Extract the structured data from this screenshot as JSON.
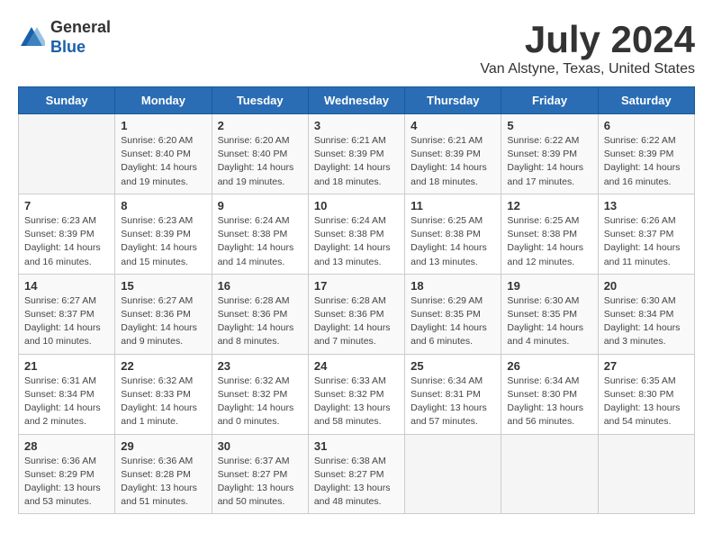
{
  "header": {
    "logo_general": "General",
    "logo_blue": "Blue",
    "month_title": "July 2024",
    "location": "Van Alstyne, Texas, United States"
  },
  "days_of_week": [
    "Sunday",
    "Monday",
    "Tuesday",
    "Wednesday",
    "Thursday",
    "Friday",
    "Saturday"
  ],
  "weeks": [
    [
      {
        "day": "",
        "text": ""
      },
      {
        "day": "1",
        "text": "Sunrise: 6:20 AM\nSunset: 8:40 PM\nDaylight: 14 hours\nand 19 minutes."
      },
      {
        "day": "2",
        "text": "Sunrise: 6:20 AM\nSunset: 8:40 PM\nDaylight: 14 hours\nand 19 minutes."
      },
      {
        "day": "3",
        "text": "Sunrise: 6:21 AM\nSunset: 8:39 PM\nDaylight: 14 hours\nand 18 minutes."
      },
      {
        "day": "4",
        "text": "Sunrise: 6:21 AM\nSunset: 8:39 PM\nDaylight: 14 hours\nand 18 minutes."
      },
      {
        "day": "5",
        "text": "Sunrise: 6:22 AM\nSunset: 8:39 PM\nDaylight: 14 hours\nand 17 minutes."
      },
      {
        "day": "6",
        "text": "Sunrise: 6:22 AM\nSunset: 8:39 PM\nDaylight: 14 hours\nand 16 minutes."
      }
    ],
    [
      {
        "day": "7",
        "text": "Sunrise: 6:23 AM\nSunset: 8:39 PM\nDaylight: 14 hours\nand 16 minutes."
      },
      {
        "day": "8",
        "text": "Sunrise: 6:23 AM\nSunset: 8:39 PM\nDaylight: 14 hours\nand 15 minutes."
      },
      {
        "day": "9",
        "text": "Sunrise: 6:24 AM\nSunset: 8:38 PM\nDaylight: 14 hours\nand 14 minutes."
      },
      {
        "day": "10",
        "text": "Sunrise: 6:24 AM\nSunset: 8:38 PM\nDaylight: 14 hours\nand 13 minutes."
      },
      {
        "day": "11",
        "text": "Sunrise: 6:25 AM\nSunset: 8:38 PM\nDaylight: 14 hours\nand 13 minutes."
      },
      {
        "day": "12",
        "text": "Sunrise: 6:25 AM\nSunset: 8:38 PM\nDaylight: 14 hours\nand 12 minutes."
      },
      {
        "day": "13",
        "text": "Sunrise: 6:26 AM\nSunset: 8:37 PM\nDaylight: 14 hours\nand 11 minutes."
      }
    ],
    [
      {
        "day": "14",
        "text": "Sunrise: 6:27 AM\nSunset: 8:37 PM\nDaylight: 14 hours\nand 10 minutes."
      },
      {
        "day": "15",
        "text": "Sunrise: 6:27 AM\nSunset: 8:36 PM\nDaylight: 14 hours\nand 9 minutes."
      },
      {
        "day": "16",
        "text": "Sunrise: 6:28 AM\nSunset: 8:36 PM\nDaylight: 14 hours\nand 8 minutes."
      },
      {
        "day": "17",
        "text": "Sunrise: 6:28 AM\nSunset: 8:36 PM\nDaylight: 14 hours\nand 7 minutes."
      },
      {
        "day": "18",
        "text": "Sunrise: 6:29 AM\nSunset: 8:35 PM\nDaylight: 14 hours\nand 6 minutes."
      },
      {
        "day": "19",
        "text": "Sunrise: 6:30 AM\nSunset: 8:35 PM\nDaylight: 14 hours\nand 4 minutes."
      },
      {
        "day": "20",
        "text": "Sunrise: 6:30 AM\nSunset: 8:34 PM\nDaylight: 14 hours\nand 3 minutes."
      }
    ],
    [
      {
        "day": "21",
        "text": "Sunrise: 6:31 AM\nSunset: 8:34 PM\nDaylight: 14 hours\nand 2 minutes."
      },
      {
        "day": "22",
        "text": "Sunrise: 6:32 AM\nSunset: 8:33 PM\nDaylight: 14 hours\nand 1 minute."
      },
      {
        "day": "23",
        "text": "Sunrise: 6:32 AM\nSunset: 8:32 PM\nDaylight: 14 hours\nand 0 minutes."
      },
      {
        "day": "24",
        "text": "Sunrise: 6:33 AM\nSunset: 8:32 PM\nDaylight: 13 hours\nand 58 minutes."
      },
      {
        "day": "25",
        "text": "Sunrise: 6:34 AM\nSunset: 8:31 PM\nDaylight: 13 hours\nand 57 minutes."
      },
      {
        "day": "26",
        "text": "Sunrise: 6:34 AM\nSunset: 8:30 PM\nDaylight: 13 hours\nand 56 minutes."
      },
      {
        "day": "27",
        "text": "Sunrise: 6:35 AM\nSunset: 8:30 PM\nDaylight: 13 hours\nand 54 minutes."
      }
    ],
    [
      {
        "day": "28",
        "text": "Sunrise: 6:36 AM\nSunset: 8:29 PM\nDaylight: 13 hours\nand 53 minutes."
      },
      {
        "day": "29",
        "text": "Sunrise: 6:36 AM\nSunset: 8:28 PM\nDaylight: 13 hours\nand 51 minutes."
      },
      {
        "day": "30",
        "text": "Sunrise: 6:37 AM\nSunset: 8:27 PM\nDaylight: 13 hours\nand 50 minutes."
      },
      {
        "day": "31",
        "text": "Sunrise: 6:38 AM\nSunset: 8:27 PM\nDaylight: 13 hours\nand 48 minutes."
      },
      {
        "day": "",
        "text": ""
      },
      {
        "day": "",
        "text": ""
      },
      {
        "day": "",
        "text": ""
      }
    ]
  ]
}
